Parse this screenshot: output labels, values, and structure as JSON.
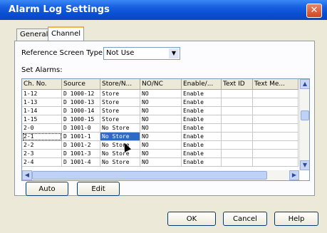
{
  "window": {
    "title": "Alarm Log Settings",
    "close_glyph": "✕"
  },
  "tabs": [
    {
      "label": "General",
      "active": false
    },
    {
      "label": "Channel",
      "active": true
    }
  ],
  "reference": {
    "label": "Reference Screen Type:",
    "value": "Not Use",
    "arrow": "▼"
  },
  "set_alarms_label": "Set Alarms:",
  "columns": [
    "Ch. No.",
    "Source",
    "Store/N...",
    "NO/NC",
    "Enable/...",
    "Text ID",
    "Text Me..."
  ],
  "rows": [
    [
      "1-12",
      "D 1000-12",
      "Store",
      "NO",
      "Enable",
      "",
      ""
    ],
    [
      "1-13",
      "D 1000-13",
      "Store",
      "NO",
      "Enable",
      "",
      ""
    ],
    [
      "1-14",
      "D 1000-14",
      "Store",
      "NO",
      "Enable",
      "",
      ""
    ],
    [
      "1-15",
      "D 1000-15",
      "Store",
      "NO",
      "Enable",
      "",
      ""
    ],
    [
      "2-0",
      "D 1001-0",
      "No Store",
      "NO",
      "Enable",
      "",
      ""
    ],
    [
      "2-1",
      "D 1001-1",
      "No Store",
      "NO",
      "Enable",
      "",
      ""
    ],
    [
      "2-2",
      "D 1001-2",
      "No Store",
      "NO",
      "Enable",
      "",
      ""
    ],
    [
      "2-3",
      "D 1001-3",
      "No Store",
      "NO",
      "Enable",
      "",
      ""
    ],
    [
      "2-4",
      "D 1001-4",
      "No Store",
      "NO",
      "Enable",
      "",
      ""
    ]
  ],
  "selected_row": 5,
  "scroll": {
    "up": "▲",
    "down": "▼",
    "left": "◀",
    "right": "▶"
  },
  "buttons": {
    "auto": "Auto",
    "edit": "Edit",
    "ok": "OK",
    "cancel": "Cancel",
    "help": "Help"
  },
  "colors": {
    "title_bar": "#0a4fd2",
    "selection": "#316ac5",
    "dialog_bg": "#ece9d8",
    "active_tab_accent": "#f2b63c"
  }
}
